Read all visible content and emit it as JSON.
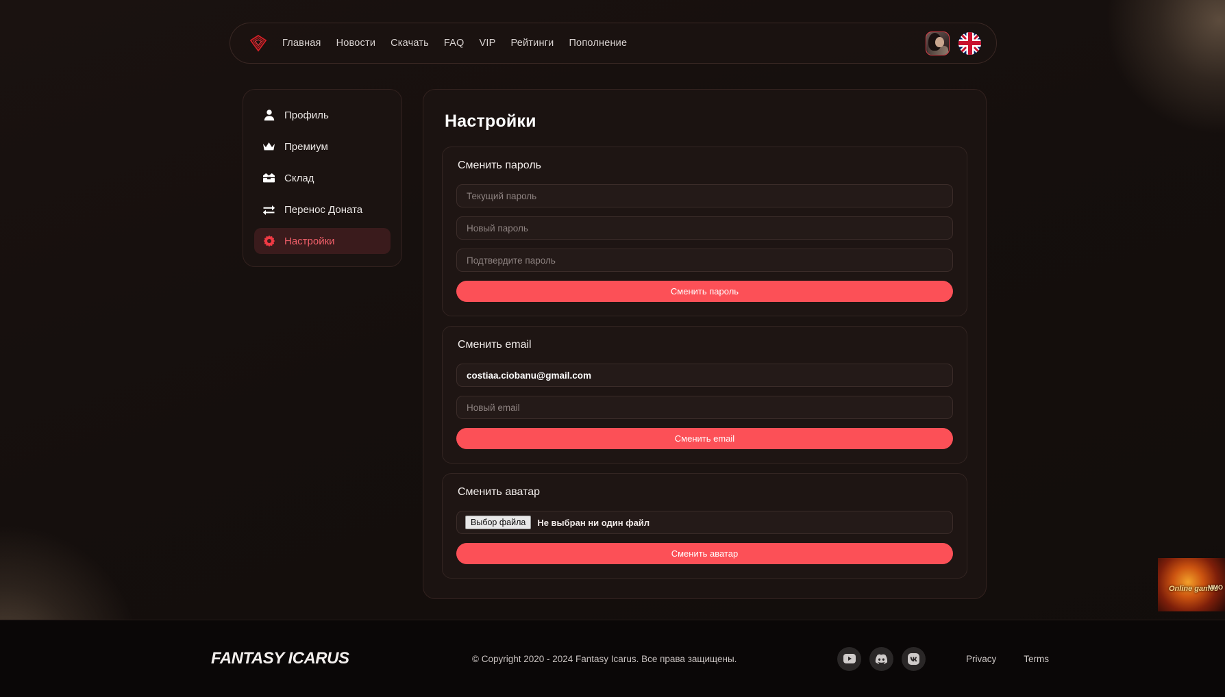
{
  "nav": {
    "logo_icon": "diamond-gem-logo-icon",
    "links": [
      {
        "label": "Главная"
      },
      {
        "label": "Новости"
      },
      {
        "label": "Скачать"
      },
      {
        "label": "FAQ"
      },
      {
        "label": "VIP"
      },
      {
        "label": "Рейтинги"
      },
      {
        "label": "Пополнение"
      }
    ],
    "avatar_icon": "user-avatar",
    "language_icon": "uk-flag-icon"
  },
  "sidebar": {
    "items": [
      {
        "label": "Профиль",
        "icon": "user-icon",
        "active": false
      },
      {
        "label": "Премиум",
        "icon": "crown-icon",
        "active": false
      },
      {
        "label": "Склад",
        "icon": "box-icon",
        "active": false
      },
      {
        "label": "Перенос Доната",
        "icon": "exchange-icon",
        "active": false
      },
      {
        "label": "Настройки",
        "icon": "gear-icon",
        "active": true
      }
    ]
  },
  "main": {
    "title": "Настройки",
    "password_section": {
      "title": "Сменить пароль",
      "current_placeholder": "Текущий пароль",
      "new_placeholder": "Новый пароль",
      "confirm_placeholder": "Подтвердите пароль",
      "submit_label": "Сменить пароль"
    },
    "email_section": {
      "title": "Сменить email",
      "current_value": "costiaa.ciobanu@gmail.com",
      "new_placeholder": "Новый email",
      "submit_label": "Сменить email"
    },
    "avatar_section": {
      "title": "Сменить аватар",
      "file_button_label": "Выбор файла",
      "file_status": "Не выбран ни один файл",
      "submit_label": "Сменить аватар"
    }
  },
  "banner_ad": {
    "line1": "Online games",
    "line2": "MMO"
  },
  "footer": {
    "logo": "FANTASY ICARUS",
    "copyright": "© Copyright 2020 - 2024 Fantasy Icarus. Все права защищены.",
    "socials": [
      {
        "name": "youtube-icon"
      },
      {
        "name": "discord-icon"
      },
      {
        "name": "vk-icon"
      }
    ],
    "links": [
      {
        "label": "Privacy"
      },
      {
        "label": "Terms"
      }
    ]
  },
  "colors": {
    "accent": "#fc5057",
    "accent_logo": "#d62027",
    "active_bg": "#3a1b1c",
    "active_text": "#f2606a",
    "page_bg": "#17100e",
    "card_bg": "#1b1311",
    "section_bg": "#1e1513",
    "field_bg": "#241a18",
    "footer_bg": "#0a0707"
  }
}
